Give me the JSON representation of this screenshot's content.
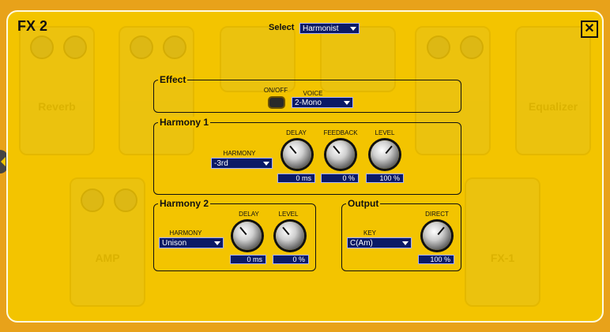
{
  "window": {
    "title": "FX 2",
    "close_glyph": "✕"
  },
  "select": {
    "label": "Select",
    "value": "Harmonist"
  },
  "effect": {
    "title": "Effect",
    "onoff_label": "ON/OFF",
    "voice_label": "VOICE",
    "voice_value": "2-Mono"
  },
  "harmony1": {
    "title": "Harmony 1",
    "harmony_label": "HARMONY",
    "harmony_value": "-3rd",
    "delay_label": "DELAY",
    "delay_value": "0 ms",
    "feedback_label": "FEEDBACK",
    "feedback_value": "0 %",
    "level_label": "LEVEL",
    "level_value": "100 %"
  },
  "harmony2": {
    "title": "Harmony 2",
    "harmony_label": "HARMONY",
    "harmony_value": "Unison",
    "delay_label": "DELAY",
    "delay_value": "0 ms",
    "level_label": "LEVEL",
    "level_value": "0 %"
  },
  "output": {
    "title": "Output",
    "key_label": "KEY",
    "key_value": "C(Am)",
    "direct_label": "DIRECT",
    "direct_value": "100 %"
  },
  "background_pedals": [
    "Reverb",
    "Equalizer",
    "AMP",
    "FX-1"
  ],
  "colors": {
    "panel": "#f3c400",
    "outer": "#e8a21a",
    "field": "#0b1a66"
  }
}
